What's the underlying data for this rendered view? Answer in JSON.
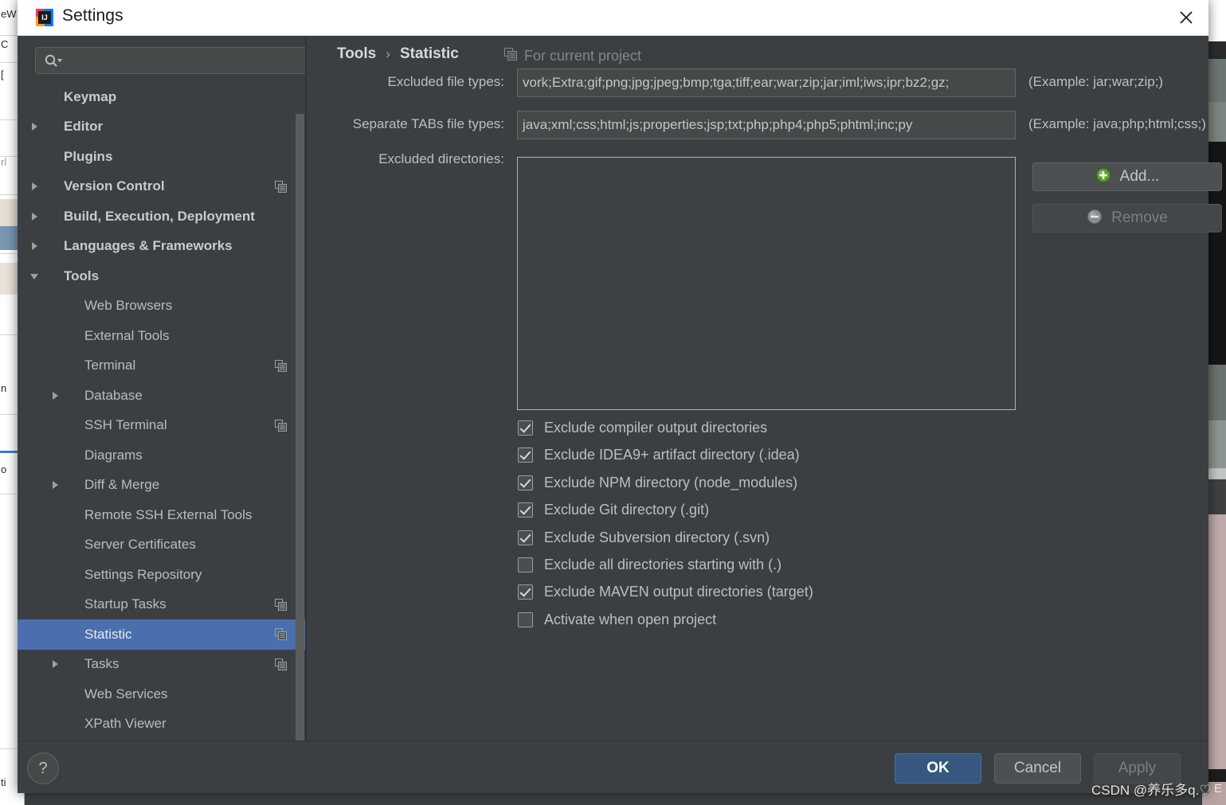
{
  "window": {
    "title": "Settings",
    "app_icon": "intellij-idea-logo",
    "close_icon": "close-icon"
  },
  "colors": {
    "dialog_bg": "#3c3f41",
    "titlebar_bg": "#ffffff",
    "selection_blue": "#4b6eaf",
    "ok_button_blue": "#365880",
    "field_bg": "#45494a",
    "text": "#bcbfc0",
    "muted_text": "#80868a",
    "add_icon_green": "#5ea83c"
  },
  "search": {
    "icon": "search-icon",
    "value": "",
    "placeholder": ""
  },
  "sidebar": {
    "scrollbar": "vertical-scrollbar",
    "items": [
      {
        "label": "Keymap",
        "level": 0,
        "arrow": "none",
        "badge": false,
        "selected": false
      },
      {
        "label": "Editor",
        "level": 0,
        "arrow": "collapsed",
        "badge": false,
        "selected": false
      },
      {
        "label": "Plugins",
        "level": 0,
        "arrow": "none",
        "badge": false,
        "selected": false
      },
      {
        "label": "Version Control",
        "level": 0,
        "arrow": "collapsed",
        "badge": true,
        "selected": false
      },
      {
        "label": "Build, Execution, Deployment",
        "level": 0,
        "arrow": "collapsed",
        "badge": false,
        "selected": false
      },
      {
        "label": "Languages & Frameworks",
        "level": 0,
        "arrow": "collapsed",
        "badge": false,
        "selected": false
      },
      {
        "label": "Tools",
        "level": 0,
        "arrow": "expanded",
        "badge": false,
        "selected": false
      },
      {
        "label": "Web Browsers",
        "level": 1,
        "arrow": "none",
        "badge": false,
        "selected": false
      },
      {
        "label": "External Tools",
        "level": 1,
        "arrow": "none",
        "badge": false,
        "selected": false
      },
      {
        "label": "Terminal",
        "level": 1,
        "arrow": "none",
        "badge": true,
        "selected": false
      },
      {
        "label": "Database",
        "level": 1,
        "arrow": "collapsed",
        "badge": false,
        "selected": false
      },
      {
        "label": "SSH Terminal",
        "level": 1,
        "arrow": "none",
        "badge": true,
        "selected": false
      },
      {
        "label": "Diagrams",
        "level": 1,
        "arrow": "none",
        "badge": false,
        "selected": false
      },
      {
        "label": "Diff & Merge",
        "level": 1,
        "arrow": "collapsed",
        "badge": false,
        "selected": false
      },
      {
        "label": "Remote SSH External Tools",
        "level": 1,
        "arrow": "none",
        "badge": false,
        "selected": false
      },
      {
        "label": "Server Certificates",
        "level": 1,
        "arrow": "none",
        "badge": false,
        "selected": false
      },
      {
        "label": "Settings Repository",
        "level": 1,
        "arrow": "none",
        "badge": false,
        "selected": false
      },
      {
        "label": "Startup Tasks",
        "level": 1,
        "arrow": "none",
        "badge": true,
        "selected": false
      },
      {
        "label": "Statistic",
        "level": 1,
        "arrow": "none",
        "badge": true,
        "selected": true
      },
      {
        "label": "Tasks",
        "level": 1,
        "arrow": "collapsed",
        "badge": true,
        "selected": false
      },
      {
        "label": "Web Services",
        "level": 1,
        "arrow": "none",
        "badge": false,
        "selected": false
      },
      {
        "label": "XPath Viewer",
        "level": 1,
        "arrow": "none",
        "badge": false,
        "selected": false
      }
    ]
  },
  "content": {
    "breadcrumb": {
      "root": "Tools",
      "separator": "›",
      "current": "Statistic"
    },
    "project_scope": {
      "icon": "project-scope-icon",
      "label": "For current project"
    },
    "fields": {
      "excluded_file_types": {
        "label": "Excluded file types:",
        "value": "vork;Extra;gif;png;jpg;jpeg;bmp;tga;tiff;ear;war;zip;jar;iml;iws;ipr;bz2;gz;",
        "example": "(Example: jar;war;zip;)"
      },
      "separate_tabs_file_types": {
        "label": "Separate TABs file types:",
        "value": "java;xml;css;html;js;properties;jsp;txt;php;php4;php5;phtml;inc;py",
        "example": "(Example: java;php;html;css;)"
      },
      "excluded_directories": {
        "label": "Excluded directories:",
        "items": []
      }
    },
    "side_buttons": [
      {
        "label": "Add...",
        "icon": "add-circle-icon",
        "enabled": true
      },
      {
        "label": "Remove",
        "icon": "remove-circle-icon",
        "enabled": false
      }
    ],
    "checkboxes": [
      {
        "label": "Exclude compiler output directories",
        "checked": true
      },
      {
        "label": "Exclude IDEA9+ artifact directory (.idea)",
        "checked": true
      },
      {
        "label": "Exclude NPM directory (node_modules)",
        "checked": true
      },
      {
        "label": "Exclude Git directory (.git)",
        "checked": true
      },
      {
        "label": "Exclude Subversion directory (.svn)",
        "checked": true
      },
      {
        "label": "Exclude all directories starting with (.)",
        "checked": false
      },
      {
        "label": "Exclude MAVEN output directories (target)",
        "checked": true
      },
      {
        "label": "Activate when open project",
        "checked": false
      }
    ]
  },
  "footer": {
    "help_label": "?",
    "ok_label": "OK",
    "cancel_label": "Cancel",
    "apply_label": "Apply"
  },
  "watermark": {
    "text": "CSDN @养乐多q.♡"
  },
  "backdrop": {
    "left_fragments": [
      "eW",
      "C",
      "[",
      "rl",
      "n",
      "o",
      "ti"
    ],
    "right_label": "E"
  }
}
